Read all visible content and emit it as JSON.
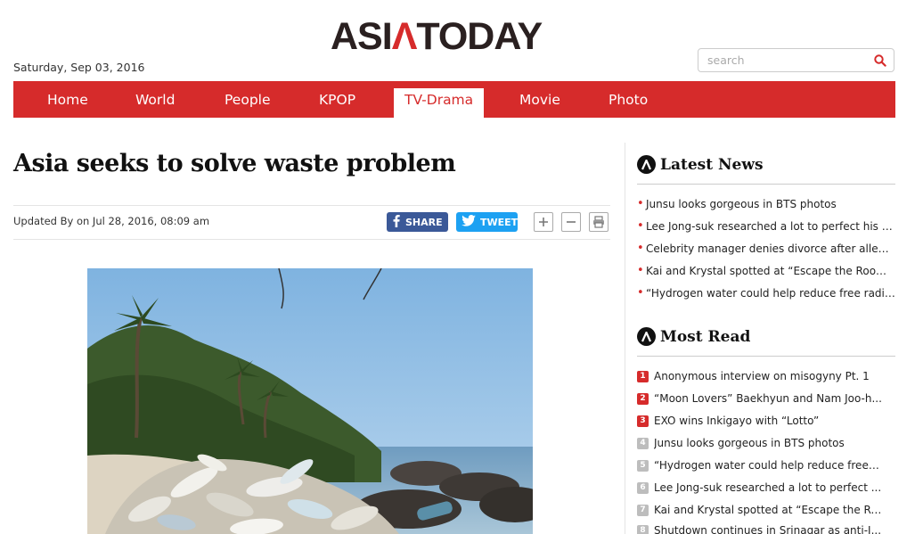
{
  "brand": {
    "logo_left": "ASI",
    "logo_mark": "Λ",
    "logo_right": "TODAY",
    "accent": "#d62b2b"
  },
  "header": {
    "date": "Saturday, Sep 03, 2016",
    "search_placeholder": "search"
  },
  "nav": {
    "items": [
      "Home",
      "World",
      "People",
      "KPOP",
      "TV-Drama",
      "Movie",
      "Photo"
    ],
    "active": "TV-Drama"
  },
  "article": {
    "headline": "Asia seeks to solve waste problem",
    "byline": "Updated By on Jul 28, 2016, 08:09 am",
    "share_label": "SHARE",
    "tweet_label": "TWEET",
    "photo_icon": "beach-waste-photo"
  },
  "latest_news": {
    "title": "Latest News",
    "items": [
      "Junsu looks gorgeous in BTS photos",
      "Lee Jong-suk researched a lot to perfect his h...",
      "Celebrity manager denies divorce after allege...",
      "Kai and Krystal spotted at “Escape the Room...",
      "“Hydrogen water could help reduce free radic..."
    ]
  },
  "most_read": {
    "title": "Most Read",
    "items": [
      {
        "rank": "1",
        "text": "Anonymous interview on misogyny Pt. 1"
      },
      {
        "rank": "2",
        "text": "“Moon Lovers” Baekhyun and Nam Joo-h..."
      },
      {
        "rank": "3",
        "text": "EXO wins Inkigayo with “Lotto”"
      },
      {
        "rank": "4",
        "text": "Junsu looks gorgeous in BTS photos"
      },
      {
        "rank": "5",
        "text": "“Hydrogen water could help reduce free r..."
      },
      {
        "rank": "6",
        "text": "Lee Jong-suk researched a lot to perfect ..."
      },
      {
        "rank": "7",
        "text": "Kai and Krystal spotted at “Escape the Ro..."
      },
      {
        "rank": "8",
        "text": "Shutdown continues in Srinagar as anti-I..."
      }
    ]
  }
}
